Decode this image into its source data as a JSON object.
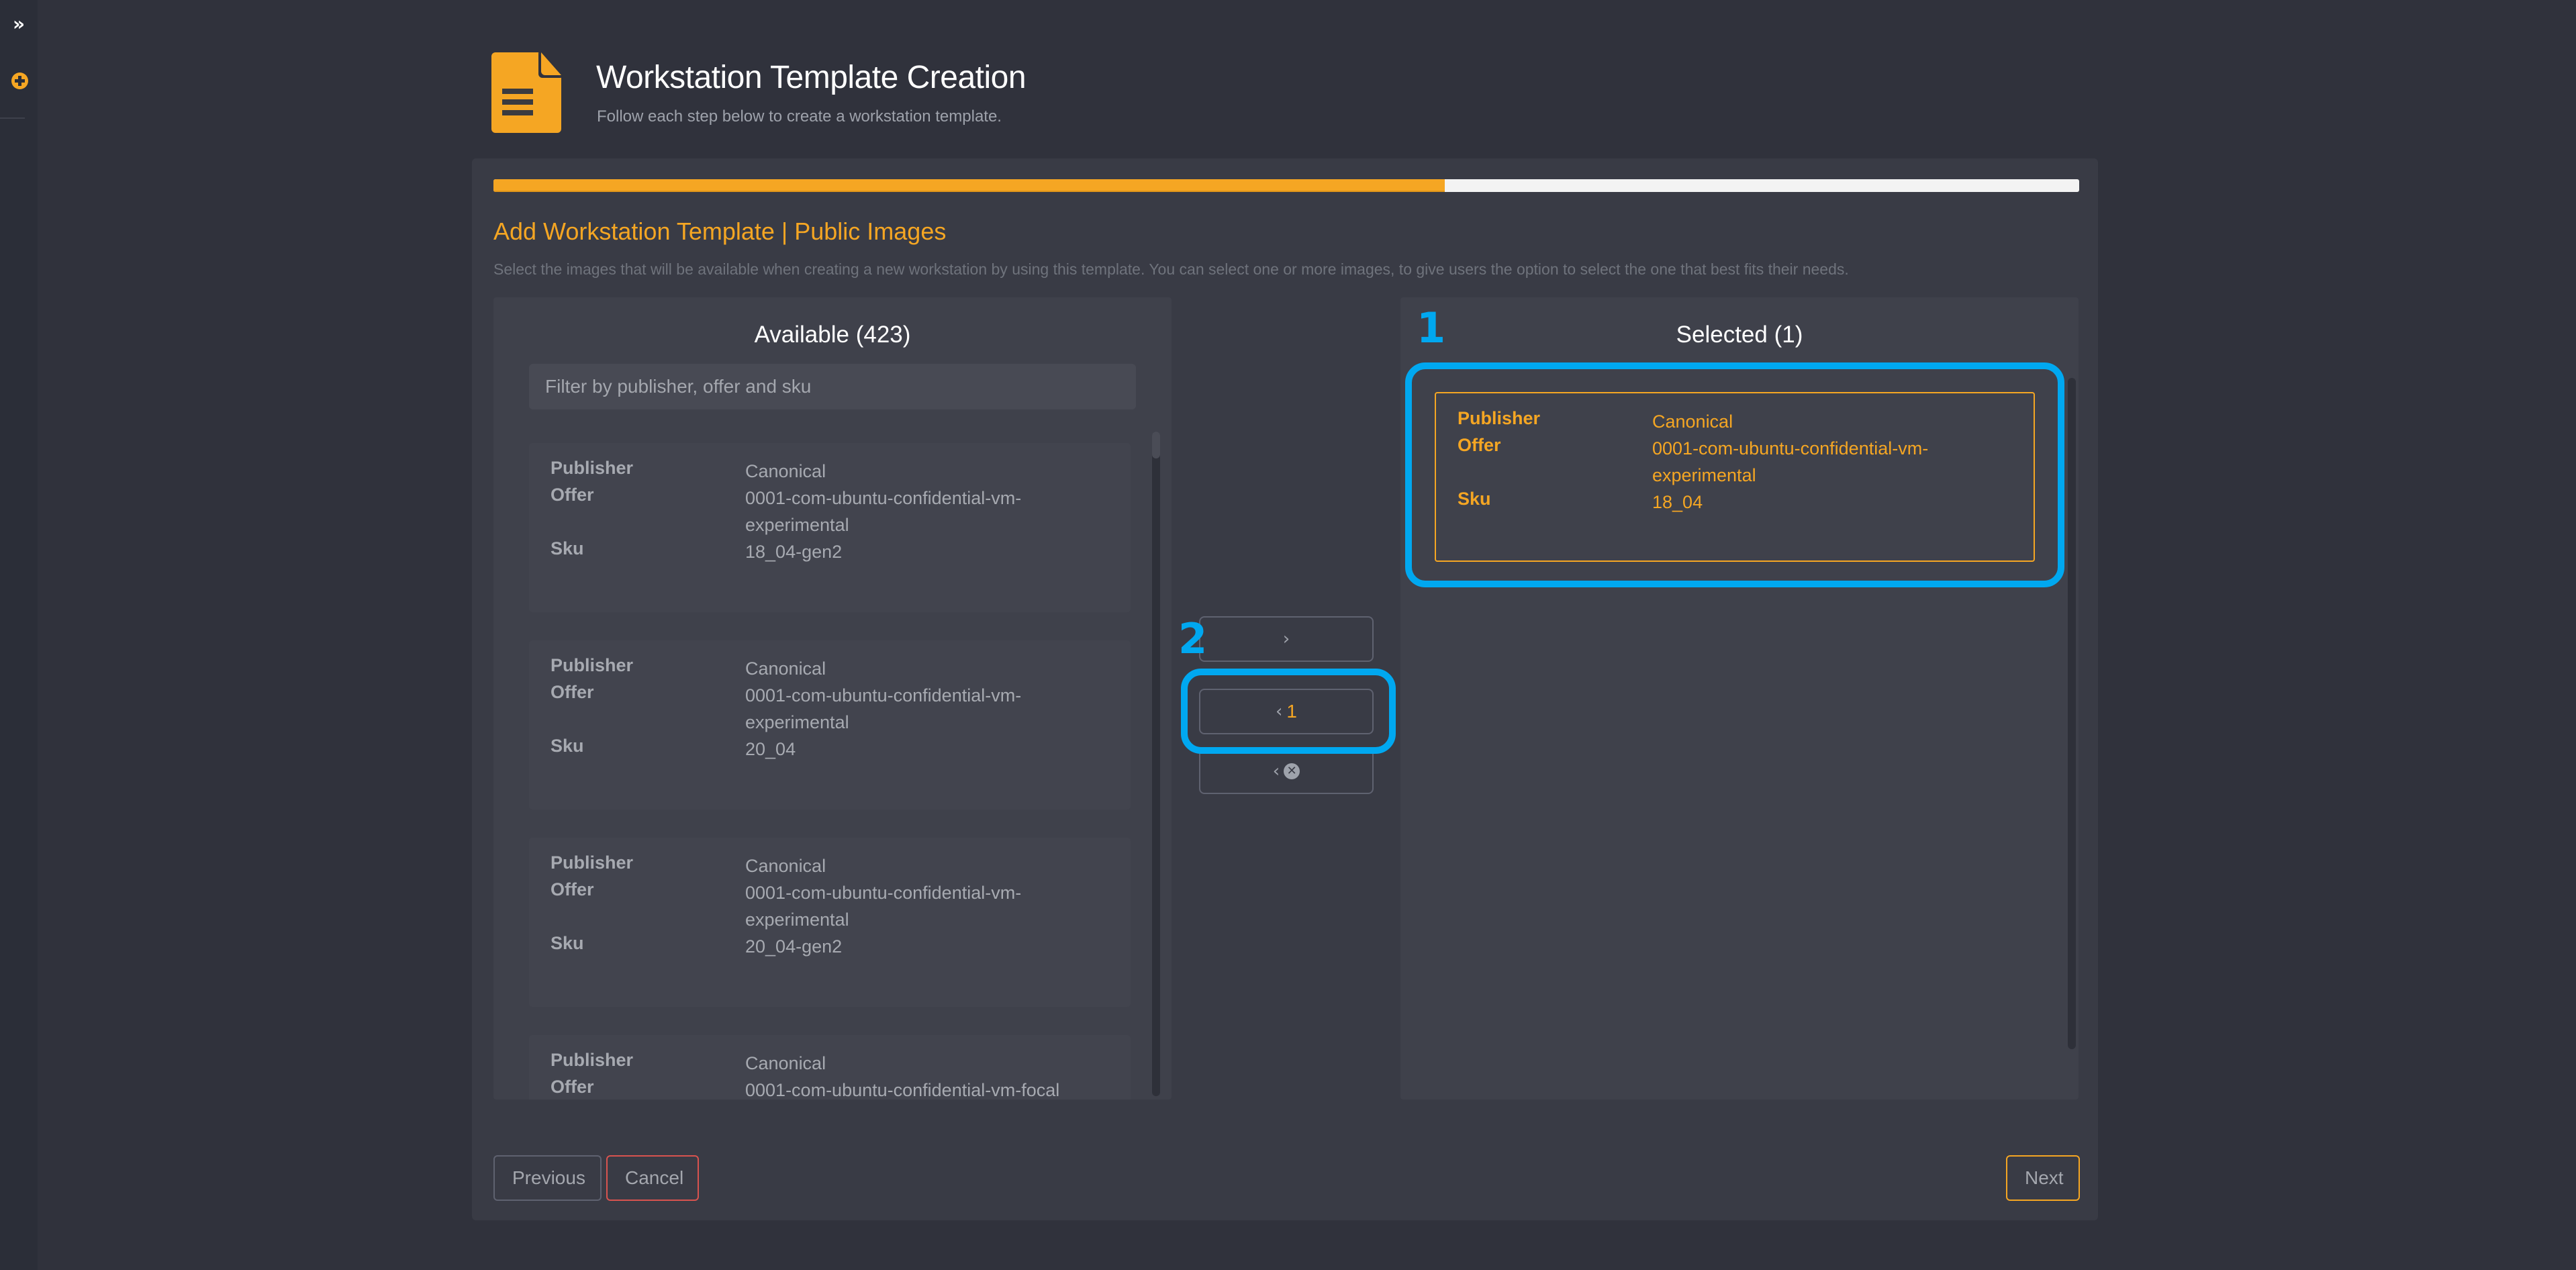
{
  "sidebar": {
    "expand_icon": "double-chevron-right-icon",
    "add_icon": "plus-circle-icon"
  },
  "header": {
    "icon": "document-icon",
    "title": "Workstation Template Creation",
    "subtitle": "Follow each step below to create a workstation template."
  },
  "wizard": {
    "progress_percent": 60,
    "progress_color": "#f5a623",
    "section_title": "Add Workstation Template | Public Images",
    "description": "Select the images that will be available when creating a new workstation by using this template. You can select one or more images, to give users the option to select the one that best fits their needs."
  },
  "available": {
    "title": "Available (423)",
    "filter_placeholder": "Filter by publisher, offer and sku",
    "labels": {
      "publisher": "Publisher",
      "offer": "Offer",
      "sku": "Sku"
    },
    "items": [
      {
        "publisher": "Canonical",
        "offer": "0001-com-ubuntu-confidential-vm-experimental",
        "sku": "18_04-gen2"
      },
      {
        "publisher": "Canonical",
        "offer": "0001-com-ubuntu-confidential-vm-experimental",
        "sku": "20_04"
      },
      {
        "publisher": "Canonical",
        "offer": "0001-com-ubuntu-confidential-vm-experimental",
        "sku": "20_04-gen2"
      },
      {
        "publisher": "Canonical",
        "offer": "0001-com-ubuntu-confidential-vm-focal",
        "sku": ""
      }
    ]
  },
  "transfer": {
    "add_label": "›",
    "remove_selected_label": "‹",
    "remove_selected_count": "1",
    "remove_all_label": "‹",
    "remove_all_icon": "x-circle-icon"
  },
  "selected": {
    "title": "Selected (1)",
    "items": [
      {
        "publisher": "Canonical",
        "offer": "0001-com-ubuntu-confidential-vm-experimental",
        "sku": "18_04"
      }
    ]
  },
  "annotations": {
    "color": "#00a8f0",
    "marker_1": "1",
    "marker_2": "2"
  },
  "footer": {
    "previous_label": "Previous",
    "cancel_label": "Cancel",
    "next_label": "Next"
  }
}
